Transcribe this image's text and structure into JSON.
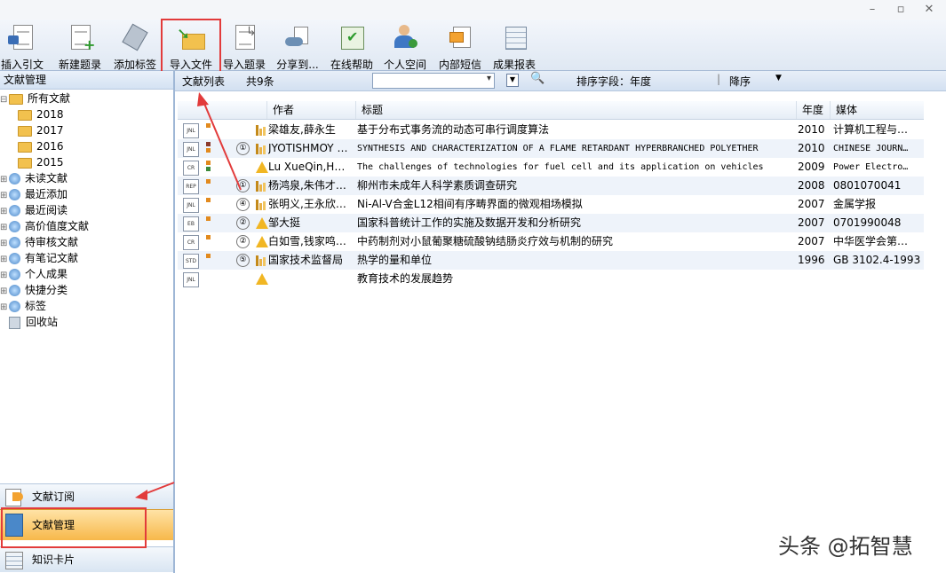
{
  "window": {
    "minimize": "–",
    "maximize": "▫",
    "close": "✕"
  },
  "toolbar": [
    {
      "label": "插入引文",
      "icon": "insert-citation-icon"
    },
    {
      "label": "新建题录",
      "icon": "new-record-icon"
    },
    {
      "label": "添加标签",
      "icon": "add-tag-icon"
    },
    {
      "label": "导入文件",
      "icon": "import-file-icon"
    },
    {
      "label": "导入题录",
      "icon": "import-record-icon"
    },
    {
      "label": "分享到...",
      "icon": "share-icon"
    },
    {
      "label": "在线帮助",
      "icon": "online-help-icon"
    },
    {
      "label": "个人空间",
      "icon": "personal-space-icon"
    },
    {
      "label": "内部短信",
      "icon": "internal-message-icon"
    },
    {
      "label": "成果报表",
      "icon": "report-icon"
    }
  ],
  "sidebar": {
    "title": "文献管理",
    "tree": [
      {
        "label": "所有文献",
        "type": "folder",
        "level": 0
      },
      {
        "label": "2018",
        "type": "folder",
        "level": 1
      },
      {
        "label": "2017",
        "type": "folder",
        "level": 1
      },
      {
        "label": "2016",
        "type": "folder",
        "level": 1
      },
      {
        "label": "2015",
        "type": "folder",
        "level": 1
      },
      {
        "label": "未读文献",
        "type": "star",
        "level": 0
      },
      {
        "label": "最近添加",
        "type": "star",
        "level": 0
      },
      {
        "label": "最近阅读",
        "type": "star",
        "level": 0
      },
      {
        "label": "高价值度文献",
        "type": "star",
        "level": 0
      },
      {
        "label": "待审核文献",
        "type": "star",
        "level": 0
      },
      {
        "label": "有笔记文献",
        "type": "star",
        "level": 0
      },
      {
        "label": "个人成果",
        "type": "star",
        "level": 0
      },
      {
        "label": "快捷分类",
        "type": "star",
        "level": 0
      },
      {
        "label": "标签",
        "type": "star",
        "level": 0
      },
      {
        "label": "回收站",
        "type": "bin",
        "level": 0
      }
    ],
    "bottom": [
      {
        "label": "文献订阅"
      },
      {
        "label": "文献管理"
      },
      {
        "label": "知识卡片"
      }
    ]
  },
  "filterbar": {
    "list_label": "文献列表",
    "count": "共9条",
    "sort_label": "排序字段：年度",
    "order": "降序"
  },
  "grid": {
    "columns": [
      "作者",
      "标题",
      "年度",
      "媒体"
    ],
    "rows": [
      {
        "type": "JNL",
        "sq1": "#e28a1e",
        "sq2": "",
        "rank": "",
        "icon": "bars",
        "author": "梁雄友,薛永生",
        "title": "基于分布式事务流的动态可串行调度算法",
        "year": "2010",
        "media": "计算机工程与…",
        "mono": false
      },
      {
        "type": "JNL",
        "sq1": "#8b3a2c",
        "sq2": "#e28a1e",
        "rank": "①",
        "icon": "bars",
        "author": "JYOTISHMOY BO…",
        "title": "SYNTHESIS AND CHARACTERIZATION OF A FLAME RETARDANT HYPERBRANCHED POLYETHER",
        "year": "2010",
        "media": "CHINESE JOURN…",
        "mono": true
      },
      {
        "type": "CR",
        "sq1": "#e28a1e",
        "sq2": "#3b8a3b",
        "rank": "",
        "icon": "warn",
        "author": "Lu XueQin,HUA…",
        "title": "The challenges of technologies for fuel cell and its application on vehicles",
        "year": "2009",
        "media": "Power Electro…",
        "mono": true
      },
      {
        "type": "REP",
        "sq1": "#e28a1e",
        "sq2": "",
        "rank": "①",
        "icon": "bars",
        "author": "杨鸿泉,朱伟才…",
        "title": "柳州市未成年人科学素质调查研究",
        "year": "2008",
        "media": "0801070041",
        "mono": false
      },
      {
        "type": "JNL",
        "sq1": "#e28a1e",
        "sq2": "",
        "rank": "④",
        "icon": "bars",
        "author": "张明义,王永欣…",
        "title": "Ni-Al-V合金L12相间有序畴界面的微观相场模拟",
        "year": "2007",
        "media": "金属学报",
        "mono": false
      },
      {
        "type": "EB",
        "sq1": "#e28a1e",
        "sq2": "",
        "rank": "②",
        "icon": "warn",
        "author": "邹大挺",
        "title": "国家科普统计工作的实施及数据开发和分析研究",
        "year": "2007",
        "media": "0701990048",
        "mono": false
      },
      {
        "type": "CR",
        "sq1": "#e28a1e",
        "sq2": "",
        "rank": "②",
        "icon": "warn",
        "author": "白如雪,钱家鸣…",
        "title": "中药制剂对小鼠葡聚糖硫酸钠结肠炎疗效与机制的研究",
        "year": "2007",
        "media": "中华医学会第…",
        "mono": false
      },
      {
        "type": "STD",
        "sq1": "#e28a1e",
        "sq2": "",
        "rank": "⑤",
        "icon": "bars",
        "author": "国家技术监督局",
        "title": "热学的量和单位",
        "year": "1996",
        "media": "GB 3102.4-1993",
        "mono": false
      },
      {
        "type": "JNL",
        "sq1": "",
        "sq2": "",
        "rank": "",
        "icon": "warn",
        "author": "",
        "title": "教育技术的发展趋势",
        "year": "",
        "media": "",
        "mono": false
      }
    ]
  },
  "watermark": "头条 @拓智慧",
  "colors": {
    "highlight": "#e23b3b",
    "accent": "#f7a21b",
    "selected_bg": "#ffd27a"
  }
}
